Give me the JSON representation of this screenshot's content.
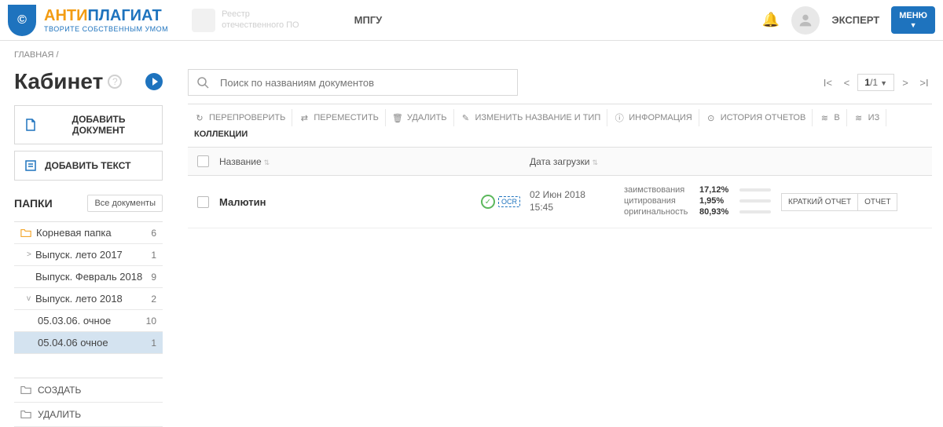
{
  "header": {
    "logo_anti": "АНТИ",
    "logo_plagiat": "ПЛАГИАТ",
    "logo_subtitle": "ТВОРИТЕ СОБСТВЕННЫМ УМОМ",
    "registry_line1": "Реестр",
    "registry_line2": "отечественного ПО",
    "org_name": "МПГУ",
    "user_role": "ЭКСПЕРТ",
    "menu_label": "МЕНЮ"
  },
  "breadcrumb": {
    "home": "ГЛАВНАЯ",
    "sep": "/"
  },
  "sidebar": {
    "title": "Кабинет",
    "add_document": "ДОБАВИТЬ ДОКУМЕНТ",
    "add_text": "ДОБАВИТЬ ТЕКСТ",
    "folders_title": "ПАПКИ",
    "all_documents": "Все документы",
    "folders": [
      {
        "name": "Корневая папка",
        "count": "6",
        "level": 0,
        "root": true
      },
      {
        "name": "Выпуск. лето 2017",
        "count": "1",
        "level": 1,
        "expand": ">"
      },
      {
        "name": "Выпуск. Февраль 2018",
        "count": "9",
        "level": 1
      },
      {
        "name": "Выпуск. лето 2018",
        "count": "2",
        "level": 1,
        "expand": "v"
      },
      {
        "name": "05.03.06. очное",
        "count": "10",
        "level": 2
      },
      {
        "name": "05.04.06 очное",
        "count": "1",
        "level": 2,
        "selected": true
      }
    ],
    "create_folder": "СОЗДАТЬ",
    "delete_folder": "УДАЛИТЬ"
  },
  "main": {
    "search_placeholder": "Поиск по названиям документов",
    "pagination": {
      "current": "1",
      "total": "/1"
    },
    "toolbar": {
      "recheck": "ПЕРЕПРОВЕРИТЬ",
      "move": "ПЕРЕМЕСТИТЬ",
      "delete": "УДАЛИТЬ",
      "rename": "ИЗМЕНИТЬ НАЗВАНИЕ И ТИП",
      "info": "ИНФОРМАЦИЯ",
      "history": "ИСТОРИЯ ОТЧЕТОВ",
      "in_label": "В",
      "out_label": "ИЗ",
      "collections": "КОЛЛЕКЦИИ"
    },
    "columns": {
      "name": "Название",
      "date": "Дата загрузки"
    },
    "documents": [
      {
        "name": "Малютин",
        "ocr": "OCR",
        "date_line1": "02 Июн 2018",
        "date_line2": "15:45",
        "borrowings_label": "заимствования",
        "borrowings_value": "17,12%",
        "citations_label": "цитирования",
        "citations_value": "1,95%",
        "originality_label": "оригинальность",
        "originality_value": "80,93%",
        "brief_report": "КРАТКИЙ ОТЧЕТ",
        "full_report": "ОТЧЕТ"
      }
    ]
  }
}
